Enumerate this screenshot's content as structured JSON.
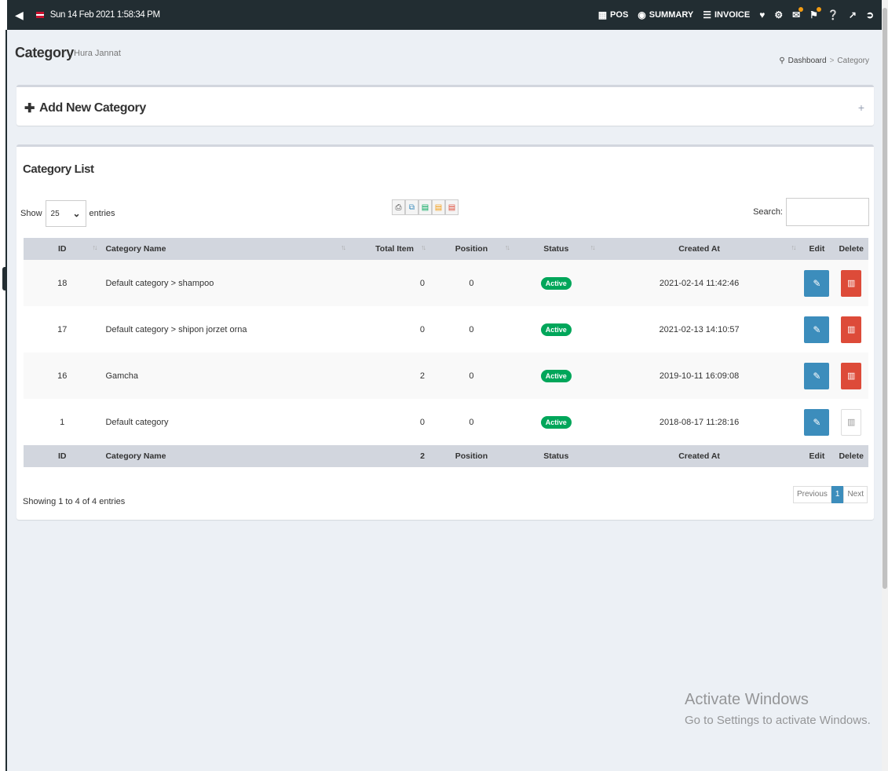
{
  "topbar": {
    "datetime": "Sun 14 Feb 2021 1:58:34 PM",
    "pos": "POS",
    "summary": "SUMMARY",
    "invoice": "INVOICE"
  },
  "header": {
    "title": "Category",
    "subtitle": "Hura Jannat",
    "breadcrumb_home": "Dashboard",
    "breadcrumb_sep": ">",
    "breadcrumb_current": "Category"
  },
  "add_box": {
    "title": "Add New Category",
    "tool": "+"
  },
  "list_box": {
    "title": "Category List",
    "show_label": "Show",
    "entries_label": "entries",
    "length_value": "25",
    "search_label": "Search:",
    "columns": {
      "id": "ID",
      "name": "Category Name",
      "total": "Total Item",
      "position": "Position",
      "status": "Status",
      "created": "Created At",
      "edit": "Edit",
      "delete": "Delete"
    },
    "rows": [
      {
        "id": "18",
        "name": "Default category > shampoo",
        "total": "0",
        "position": "0",
        "status": "Active",
        "created": "2021-02-14 11:42:46"
      },
      {
        "id": "17",
        "name": "Default category > shipon jorzet orna",
        "total": "0",
        "position": "0",
        "status": "Active",
        "created": "2021-02-13 14:10:57"
      },
      {
        "id": "16",
        "name": "Gamcha",
        "total": "2",
        "position": "0",
        "status": "Active",
        "created": "2019-10-11 16:09:08"
      },
      {
        "id": "1",
        "name": "Default category",
        "total": "0",
        "position": "0",
        "status": "Active",
        "created": "2018-08-17 11:28:16"
      }
    ],
    "footer": {
      "id": "ID",
      "name": "Category Name",
      "total": "2",
      "position": "Position",
      "status": "Status",
      "created": "Created At",
      "edit": "Edit",
      "delete": "Delete"
    },
    "info": "Showing 1 to 4 of 4 entries",
    "pager": {
      "previous": "Previous",
      "current": "1",
      "next": "Next"
    }
  },
  "watermark": {
    "line1": "Activate Windows",
    "line2": "Go to Settings to activate Windows."
  },
  "colors": {
    "topbar": "#222d32",
    "primary": "#3c8dbc",
    "danger": "#dd4b39",
    "success": "#00a65a"
  }
}
